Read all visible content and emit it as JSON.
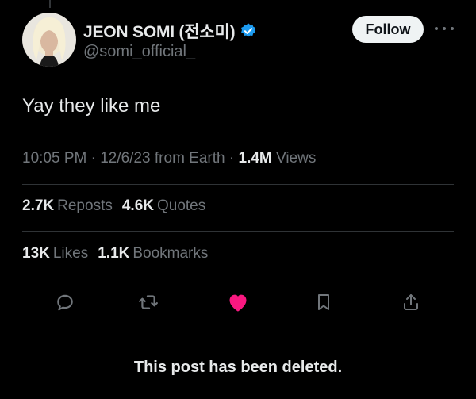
{
  "author": {
    "display_name": "JEON SOMI (전소미)",
    "handle": "@somi_official_",
    "verified": true
  },
  "follow_button": {
    "label": "Follow"
  },
  "more_icon": "more-dots-icon",
  "tweet": {
    "text": "Yay they like me",
    "time": "10:05 PM",
    "date": "12/6/23",
    "source": "from Earth",
    "views_count": "1.4M",
    "views_label": "Views",
    "separator": "·"
  },
  "stats_row_1": [
    {
      "count": "2.7K",
      "label": "Reposts"
    },
    {
      "count": "4.6K",
      "label": "Quotes"
    }
  ],
  "stats_row_2": [
    {
      "count": "13K",
      "label": "Likes"
    },
    {
      "count": "1.1K",
      "label": "Bookmarks"
    }
  ],
  "actions": [
    {
      "icon": "reply-icon"
    },
    {
      "icon": "repost-icon"
    },
    {
      "icon": "like-icon",
      "state": "liked"
    },
    {
      "icon": "bookmark-icon"
    },
    {
      "icon": "share-icon"
    }
  ],
  "notice": "This post has been deleted.",
  "colors": {
    "background": "#000000",
    "text_primary": "#e7e9ea",
    "text_secondary": "#71767b",
    "verified_blue": "#1d9bf0",
    "like_pink": "#f91880",
    "divider": "#2f3336"
  }
}
